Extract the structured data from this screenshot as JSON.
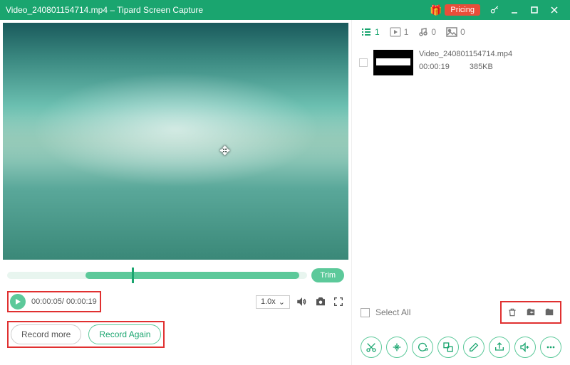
{
  "titlebar": {
    "filename": "Video_240801154714.mp4",
    "separator": " – ",
    "app": "Tipard Screen Capture",
    "pricing": "Pricing"
  },
  "filters": {
    "list_count": "1",
    "video_count": "1",
    "audio_count": "0",
    "image_count": "0"
  },
  "file": {
    "name": "Video_240801154714.mp4",
    "duration": "00:00:19",
    "size": "385KB"
  },
  "timeline": {
    "trim": "Trim"
  },
  "controls": {
    "current": "00:00:05",
    "sep": "/ ",
    "total": "00:00:19",
    "speed": "1.0x"
  },
  "buttons": {
    "record_more": "Record more",
    "record_again": "Record Again"
  },
  "select": {
    "all": "Select All"
  }
}
